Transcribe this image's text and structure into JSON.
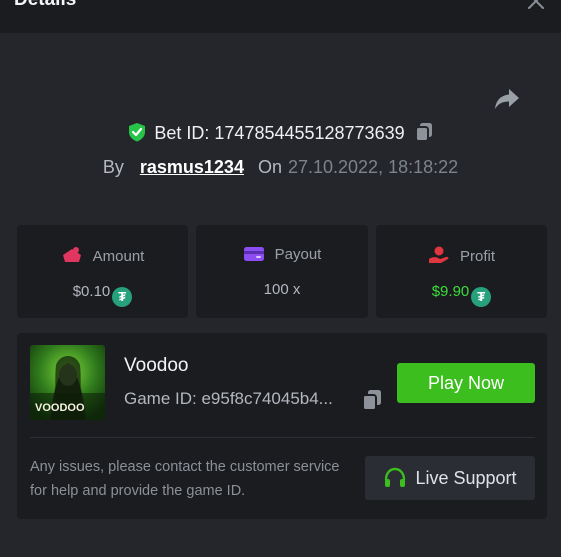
{
  "header": {
    "title": "Details"
  },
  "bet": {
    "id_label": "Bet ID: 1747854455128773639",
    "by_label": "By",
    "username": "rasmus1234",
    "on_label": "On",
    "datetime": "27.10.2022, 18:18:22"
  },
  "stats": {
    "amount": {
      "label": "Amount",
      "value": "$0.10"
    },
    "payout": {
      "label": "Payout",
      "value": "100 x"
    },
    "profit": {
      "label": "Profit",
      "value": "$9.90"
    }
  },
  "game": {
    "thumb_label": "VOODOO",
    "name": "Voodoo",
    "id_text": "Game ID: e95f8c74045b4...",
    "play_label": "Play Now",
    "notice": "Any issues, please contact the customer service for help and provide the game ID.",
    "support_label": "Live Support"
  },
  "coin_glyph": "₮",
  "colors": {
    "accent_green": "#3dbe1f",
    "profit_green": "#3ddc3d",
    "tether": "#26a17b",
    "amount_icon": "#e0365f",
    "payout_icon": "#8c4df2",
    "profit_icon": "#e0363f"
  },
  "icons": [
    "close-icon",
    "share-icon",
    "shield-check-icon",
    "copy-icon",
    "amount-icon",
    "payout-card-icon",
    "profit-hand-icon",
    "tether-coin-icon",
    "headset-icon"
  ]
}
